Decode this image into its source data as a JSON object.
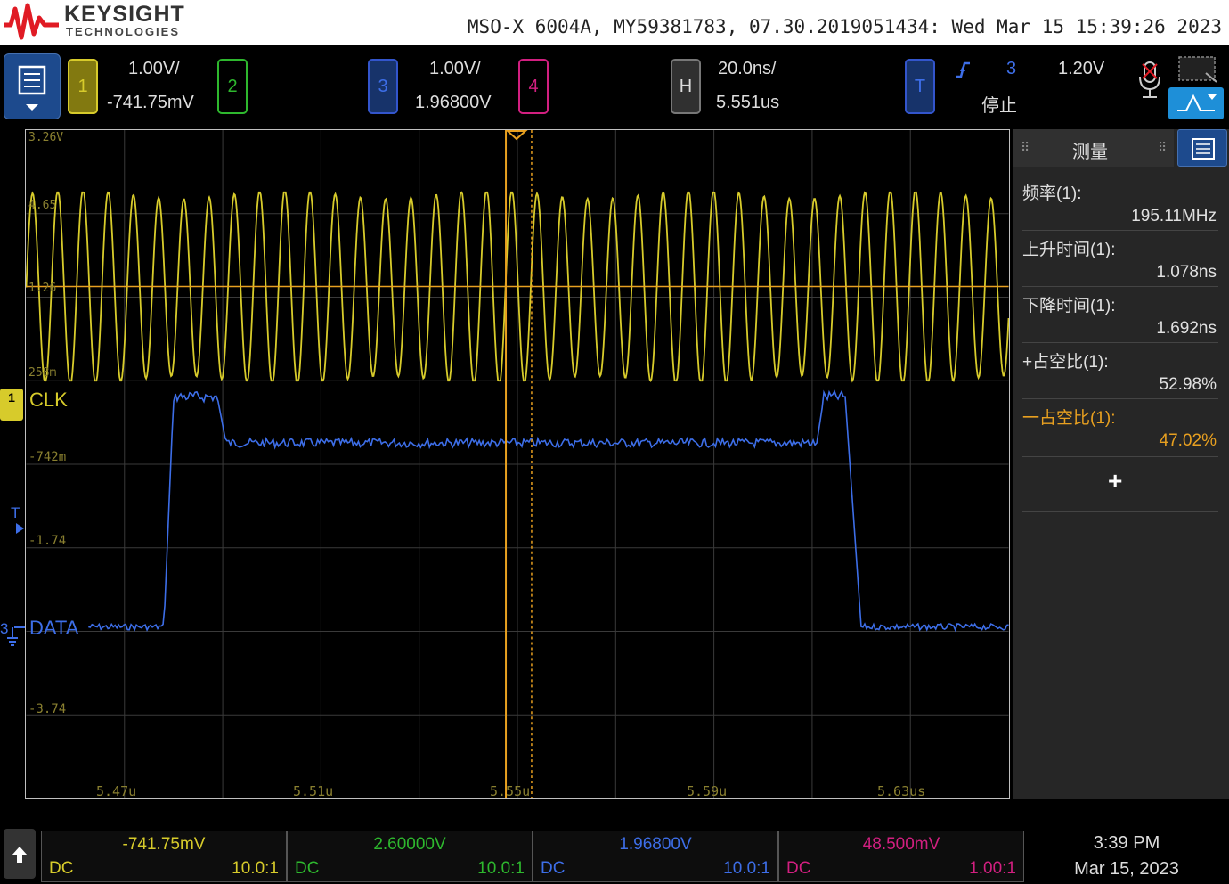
{
  "header": {
    "brand": "KEYSIGHT",
    "brand_sub": "TECHNOLOGIES",
    "instrument_info": "MSO-X 6004A, MY59381783, 07.30.2019051434: Wed Mar 15 15:39:26 2023"
  },
  "controls": {
    "ch1": {
      "label": "1",
      "scale": "1.00V/",
      "offset": "-741.75mV"
    },
    "ch2": {
      "label": "2"
    },
    "ch3": {
      "label": "3",
      "scale": "1.00V/",
      "offset": "1.96800V"
    },
    "ch4": {
      "label": "4"
    },
    "horizontal": {
      "label": "H",
      "scale": "20.0ns/",
      "delay": "5.551us"
    },
    "trigger": {
      "label": "T",
      "source": "3",
      "level": "1.20V",
      "status": "停止"
    }
  },
  "graticule": {
    "ch1_levels": [
      "3.26V",
      "4.65",
      "1.26",
      "258m"
    ],
    "ch3_levels": [
      "-742m",
      "-1.74",
      "-3.74"
    ],
    "time_labels": [
      "5.47u",
      "5.51u",
      "5.55u",
      "5.59u",
      "5.63us"
    ],
    "ch1_marker": "1",
    "ch3_marker": "3",
    "trigger_marker": "T",
    "label_clk": "CLK",
    "label_data": "DATA"
  },
  "measurements": {
    "title": "测量",
    "items": [
      {
        "name": "频率(1):",
        "value": "195.11MHz",
        "color": "#e0e0e0"
      },
      {
        "name": "上升时间(1):",
        "value": "1.078ns",
        "color": "#e0e0e0"
      },
      {
        "name": "下降时间(1):",
        "value": "1.692ns",
        "color": "#e0e0e0"
      },
      {
        "name": "+占空比(1):",
        "value": "52.98%",
        "color": "#e0e0e0"
      },
      {
        "name": "一占空比(1):",
        "value": "47.02%",
        "color": "#e8a020"
      }
    ],
    "add_symbol": "+"
  },
  "bottom": {
    "channels": [
      {
        "value": "-741.75mV",
        "coupling": "DC",
        "probe": "10.0:1",
        "color": "#d7cb2b"
      },
      {
        "value": "2.60000V",
        "coupling": "DC",
        "probe": "10.0:1",
        "color": "#2eb82e"
      },
      {
        "value": "1.96800V",
        "coupling": "DC",
        "probe": "10.0:1",
        "color": "#3d6ee8"
      },
      {
        "value": "48.500mV",
        "coupling": "DC",
        "probe": "1.00:1",
        "color": "#d21f80"
      }
    ],
    "time": "3:39 PM",
    "date": "Mar 15, 2023"
  },
  "colors": {
    "ch1": "#d7cb2b",
    "ch2": "#2eb82e",
    "ch3": "#3d6ee8",
    "ch4": "#d21f80",
    "cursor": "#e8a020"
  }
}
